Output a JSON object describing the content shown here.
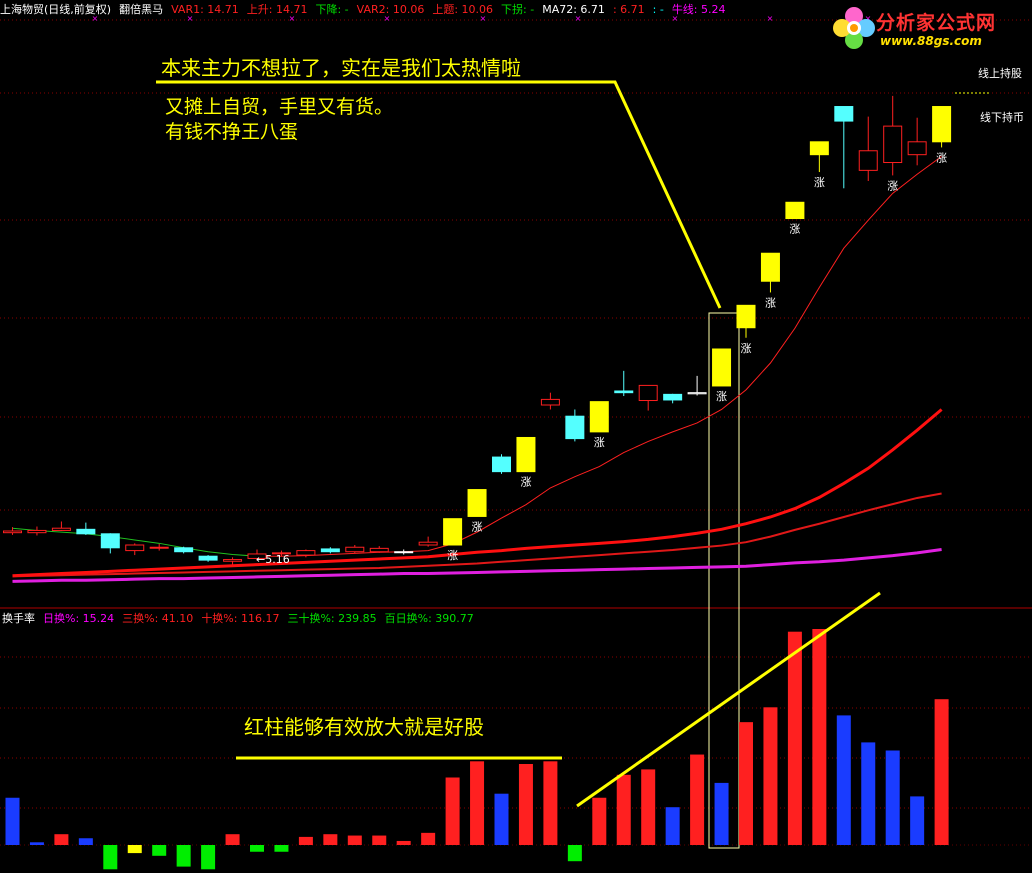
{
  "header": {
    "stock": "上海物贸(日线,前复权)",
    "indicator": "翻倍黑马",
    "var1": "VAR1: 14.71",
    "up": "上升: 14.71",
    "down": "下降: -",
    "var2": "VAR2: 10.06",
    "up_line": "上题: 10.06",
    "turn_down": "下拐: -",
    "ma72": "MA72: 6.71",
    "dots": ": 6.71",
    "dash": ": -",
    "bull": "牛线: 5.24",
    "colors": {
      "white": "#ffffff",
      "red": "#ff2020",
      "green": "#00e000",
      "magenta": "#ff00ff",
      "cyan": "#00ffff"
    }
  },
  "sub_header": {
    "name": "换手率",
    "day": "日换%: 15.24",
    "three": "三换%: 41.10",
    "ten": "十换%: 116.17",
    "thirty": "三十换%: 239.85",
    "hundred": "百日换%: 390.77"
  },
  "annotations": {
    "main_title": "本来主力不想拉了，实在是我们太热情啦",
    "line2": "又摊上自贸，手里又有货。",
    "line3": "有钱不挣王八蛋",
    "volume_note": "红柱能够有效放大就是好股",
    "low_label": "←5.16",
    "above_line": "线上持股",
    "below_line": "线下持币",
    "rise_mark": "涨"
  },
  "logo": {
    "title": "分析家公式网",
    "url": "www.88gs.com"
  },
  "candles": [
    {
      "o": 4.95,
      "c": 4.92,
      "h": 5.02,
      "l": 4.88,
      "col": "r"
    },
    {
      "o": 4.92,
      "c": 4.96,
      "h": 5.03,
      "l": 4.87,
      "col": "r"
    },
    {
      "o": 4.96,
      "c": 5.0,
      "h": 5.12,
      "l": 4.95,
      "col": "r"
    },
    {
      "o": 4.98,
      "c": 4.9,
      "h": 5.1,
      "l": 4.88,
      "col": "c"
    },
    {
      "o": 4.9,
      "c": 4.65,
      "h": 4.91,
      "l": 4.55,
      "col": "c"
    },
    {
      "o": 4.7,
      "c": 4.6,
      "h": 4.73,
      "l": 4.52,
      "col": "r"
    },
    {
      "o": 4.66,
      "c": 4.66,
      "h": 4.72,
      "l": 4.6,
      "col": "r"
    },
    {
      "o": 4.65,
      "c": 4.58,
      "h": 4.67,
      "l": 4.55,
      "col": "c"
    },
    {
      "o": 4.5,
      "c": 4.43,
      "h": 4.52,
      "l": 4.4,
      "col": "c"
    },
    {
      "o": 4.41,
      "c": 4.44,
      "h": 4.48,
      "l": 4.35,
      "col": "r"
    },
    {
      "o": 4.46,
      "c": 4.54,
      "h": 4.62,
      "l": 4.42,
      "col": "r"
    },
    {
      "o": 4.55,
      "c": 4.56,
      "h": 4.6,
      "l": 4.5,
      "col": "r"
    },
    {
      "o": 4.52,
      "c": 4.6,
      "h": 4.62,
      "l": 4.48,
      "col": "r"
    },
    {
      "o": 4.58,
      "c": 4.63,
      "h": 4.66,
      "l": 4.55,
      "col": "c"
    },
    {
      "o": 4.58,
      "c": 4.66,
      "h": 4.7,
      "l": 4.55,
      "col": "r"
    },
    {
      "o": 4.64,
      "c": 4.58,
      "h": 4.68,
      "l": 4.56,
      "col": "r"
    },
    {
      "o": 4.58,
      "c": 4.58,
      "h": 4.62,
      "l": 4.53,
      "col": "w"
    },
    {
      "o": 4.75,
      "c": 4.7,
      "h": 4.85,
      "l": 4.67,
      "col": "r"
    },
    {
      "o": 4.7,
      "c": 5.17,
      "h": 5.17,
      "l": 4.7,
      "col": "y"
    },
    {
      "o": 5.21,
      "c": 5.69,
      "h": 5.69,
      "l": 5.21,
      "col": "y"
    },
    {
      "o": 6.27,
      "c": 6.01,
      "h": 6.32,
      "l": 5.97,
      "col": "c"
    },
    {
      "o": 6.01,
      "c": 6.62,
      "h": 6.62,
      "l": 6.01,
      "col": "y"
    },
    {
      "o": 7.2,
      "c": 7.3,
      "h": 7.42,
      "l": 7.12,
      "col": "r"
    },
    {
      "o": 7.0,
      "c": 6.6,
      "h": 7.12,
      "l": 6.55,
      "col": "c"
    },
    {
      "o": 6.72,
      "c": 7.26,
      "h": 7.26,
      "l": 6.72,
      "col": "y"
    },
    {
      "o": 7.45,
      "c": 7.42,
      "h": 7.81,
      "l": 7.36,
      "col": "c"
    },
    {
      "o": 7.28,
      "c": 7.55,
      "h": 7.55,
      "l": 7.1,
      "col": "r"
    },
    {
      "o": 7.39,
      "c": 7.29,
      "h": 7.4,
      "l": 7.23,
      "col": "c"
    },
    {
      "o": 7.42,
      "c": 7.4,
      "h": 7.72,
      "l": 7.37,
      "col": "w"
    },
    {
      "o": 7.54,
      "c": 8.2,
      "h": 8.2,
      "l": 7.54,
      "col": "y"
    },
    {
      "o": 8.58,
      "c": 8.98,
      "h": 8.98,
      "l": 8.4,
      "col": "y"
    },
    {
      "o": 9.41,
      "c": 9.91,
      "h": 9.91,
      "l": 9.21,
      "col": "y"
    },
    {
      "o": 10.53,
      "c": 10.82,
      "h": 10.82,
      "l": 10.53,
      "col": "y"
    },
    {
      "o": 11.67,
      "c": 11.9,
      "h": 11.9,
      "l": 11.36,
      "col": "y"
    },
    {
      "o": 12.27,
      "c": 12.53,
      "h": 12.53,
      "l": 11.07,
      "col": "c"
    },
    {
      "o": 11.39,
      "c": 11.74,
      "h": 12.35,
      "l": 11.2,
      "col": "r"
    },
    {
      "o": 11.53,
      "c": 12.18,
      "h": 12.72,
      "l": 11.3,
      "col": "r"
    },
    {
      "o": 11.67,
      "c": 11.9,
      "h": 12.33,
      "l": 11.48,
      "col": "r"
    },
    {
      "o": 11.9,
      "c": 12.53,
      "h": 12.53,
      "l": 11.8,
      "col": "y"
    }
  ],
  "rise_marks": [
    18,
    19,
    21,
    24,
    29,
    30,
    31,
    32,
    33,
    36,
    38
  ],
  "series": {
    "fast": [
      5.0,
      4.96,
      4.93,
      4.9,
      4.85,
      4.79,
      4.73,
      4.65,
      4.58,
      4.53,
      4.5,
      4.5,
      4.51,
      4.53,
      4.55,
      4.57,
      4.58,
      4.6,
      4.72,
      4.93,
      5.18,
      5.42,
      5.72,
      5.92,
      6.1,
      6.35,
      6.55,
      6.72,
      6.88,
      7.12,
      7.47,
      7.95,
      8.57,
      9.3,
      10.0,
      10.5,
      10.98,
      11.32,
      11.64
    ],
    "ma_long": [
      4.15,
      4.17,
      4.19,
      4.21,
      4.23,
      4.25,
      4.27,
      4.29,
      4.31,
      4.33,
      4.35,
      4.37,
      4.39,
      4.41,
      4.43,
      4.45,
      4.47,
      4.49,
      4.53,
      4.57,
      4.6,
      4.64,
      4.67,
      4.7,
      4.73,
      4.76,
      4.8,
      4.85,
      4.91,
      4.98,
      5.08,
      5.2,
      5.35,
      5.55,
      5.8,
      6.07,
      6.4,
      6.75,
      7.12
    ],
    "ma72": [
      4.14,
      4.15,
      4.16,
      4.17,
      4.18,
      4.19,
      4.2,
      4.21,
      4.22,
      4.23,
      4.24,
      4.25,
      4.26,
      4.27,
      4.28,
      4.29,
      4.31,
      4.33,
      4.35,
      4.37,
      4.4,
      4.43,
      4.46,
      4.49,
      4.52,
      4.55,
      4.58,
      4.61,
      4.65,
      4.69,
      4.75,
      4.85,
      4.97,
      5.08,
      5.2,
      5.32,
      5.43,
      5.54,
      5.62
    ],
    "bull": [
      4.05,
      4.06,
      4.07,
      4.07,
      4.08,
      4.09,
      4.1,
      4.1,
      4.11,
      4.12,
      4.13,
      4.14,
      4.15,
      4.16,
      4.17,
      4.18,
      4.19,
      4.19,
      4.2,
      4.21,
      4.22,
      4.23,
      4.24,
      4.25,
      4.26,
      4.27,
      4.28,
      4.29,
      4.3,
      4.31,
      4.32,
      4.35,
      4.38,
      4.4,
      4.43,
      4.47,
      4.51,
      4.56,
      4.62
    ]
  },
  "turnover": [
    {
      "v": 3.5,
      "col": "b"
    },
    {
      "v": 0.2,
      "col": "b"
    },
    {
      "v": 0.8,
      "col": "r"
    },
    {
      "v": 0.5,
      "col": "b"
    },
    {
      "v": -1.8,
      "col": "g"
    },
    {
      "v": -0.6,
      "col": "y"
    },
    {
      "v": -0.8,
      "col": "g"
    },
    {
      "v": -1.6,
      "col": "g"
    },
    {
      "v": -1.8,
      "col": "g"
    },
    {
      "v": 0.8,
      "col": "r"
    },
    {
      "v": -0.5,
      "col": "g"
    },
    {
      "v": -0.5,
      "col": "g"
    },
    {
      "v": 0.6,
      "col": "r"
    },
    {
      "v": 0.8,
      "col": "r"
    },
    {
      "v": 0.7,
      "col": "r"
    },
    {
      "v": 0.7,
      "col": "r"
    },
    {
      "v": 0.3,
      "col": "r"
    },
    {
      "v": 0.9,
      "col": "r"
    },
    {
      "v": 5.0,
      "col": "r"
    },
    {
      "v": 6.2,
      "col": "r"
    },
    {
      "v": 3.8,
      "col": "b"
    },
    {
      "v": 6.0,
      "col": "r"
    },
    {
      "v": 6.2,
      "col": "r"
    },
    {
      "v": -1.2,
      "col": "g"
    },
    {
      "v": 3.5,
      "col": "r"
    },
    {
      "v": 5.2,
      "col": "r"
    },
    {
      "v": 5.6,
      "col": "r"
    },
    {
      "v": 2.8,
      "col": "b"
    },
    {
      "v": 6.7,
      "col": "r"
    },
    {
      "v": 4.6,
      "col": "b"
    },
    {
      "v": 9.1,
      "col": "r"
    },
    {
      "v": 10.2,
      "col": "r"
    },
    {
      "v": 15.8,
      "col": "r"
    },
    {
      "v": 16.0,
      "col": "r"
    },
    {
      "v": 9.6,
      "col": "b"
    },
    {
      "v": 7.6,
      "col": "b"
    },
    {
      "v": 7.0,
      "col": "b"
    },
    {
      "v": 3.6,
      "col": "b"
    },
    {
      "v": 10.8,
      "col": "r"
    }
  ]
}
